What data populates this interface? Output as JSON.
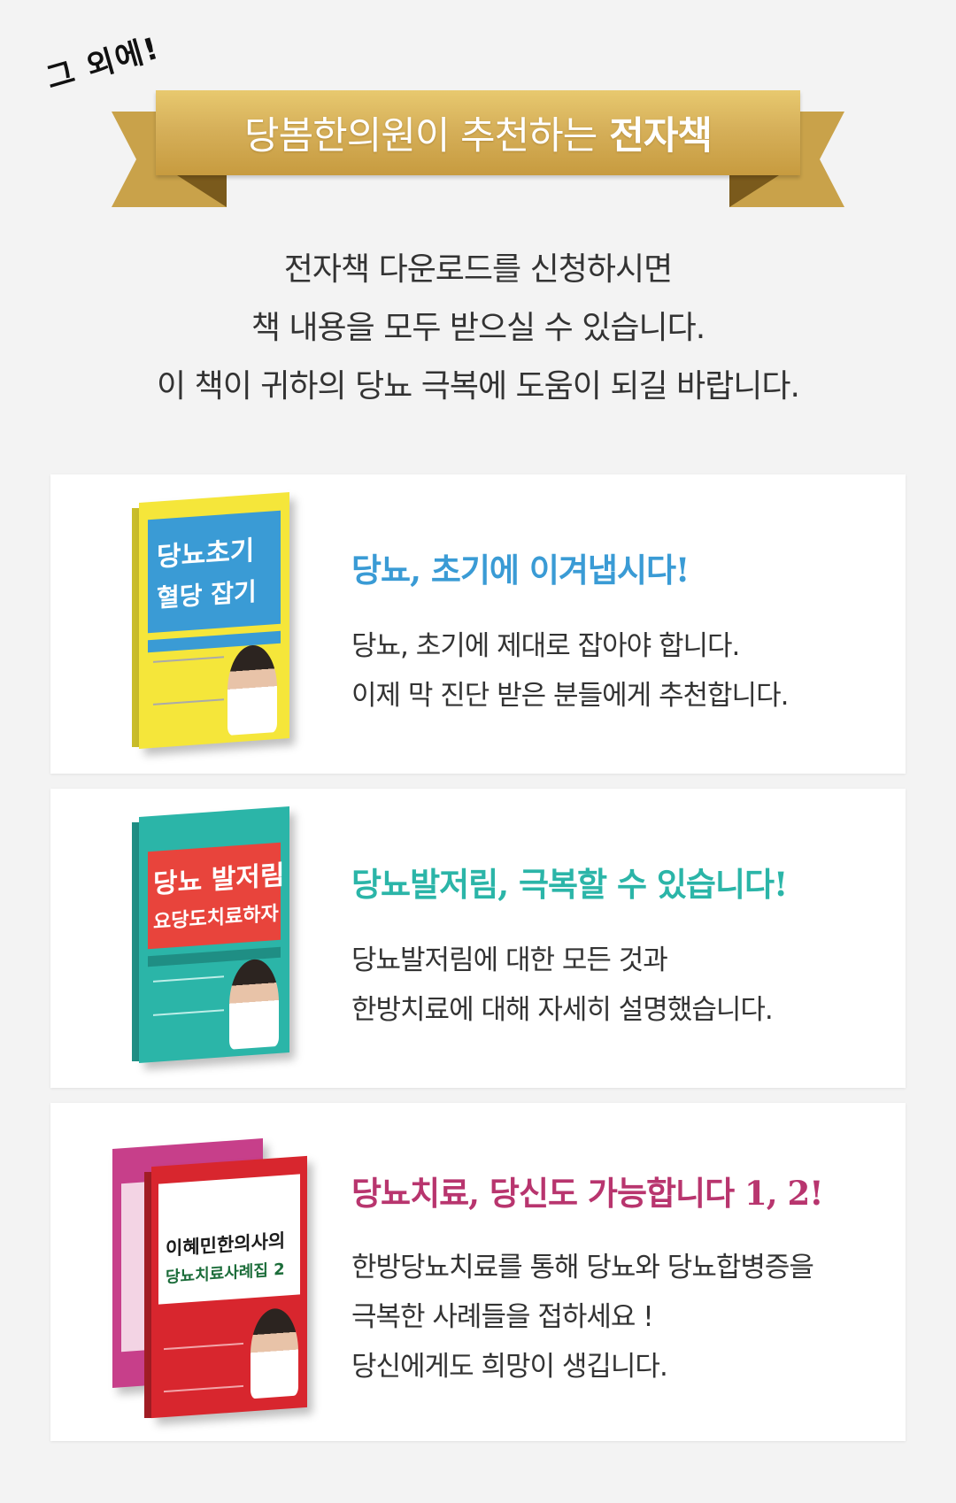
{
  "header": {
    "handwritten": "그 외에!",
    "banner_regular": "당봄한의원이 추천하는",
    "banner_bold": "전자책"
  },
  "intro": {
    "lines": [
      "전자책 다운로드를 신청하시면",
      "책 내용을 모두 받으실 수 있습니다.",
      "이 책이 귀하의 당뇨 극복에 도움이 되길 바랍니다."
    ]
  },
  "books": [
    {
      "title": "당뇨, 초기에 이겨냅시다!",
      "title_color": "#3a9bd5",
      "desc": [
        "당뇨, 초기에 제대로 잡아야 합니다.",
        "이제 막 진단 받은 분들에게 추천합니다."
      ],
      "cover_line1": "당뇨초기",
      "cover_line2": "혈당 잡기",
      "cover_bg": "#f5e63a",
      "cover_accent": "#3a9bd5"
    },
    {
      "title": "당뇨발저림, 극복할 수 있습니다!",
      "title_color": "#2bb5a8",
      "desc": [
        "당뇨발저림에 대한 모든 것과",
        "한방치료에 대해 자세히 설명했습니다."
      ],
      "cover_line1": "당뇨 발저림",
      "cover_line2": "요당도치료하자",
      "cover_bg": "#2bb5a8",
      "cover_accent": "#e8443c"
    },
    {
      "title": "당뇨치료, 당신도 가능합니다 1, 2!",
      "title_color": "#b8356e",
      "desc": [
        "한방당뇨치료를 통해 당뇨와 당뇨합병증을",
        "극복한 사례들을 접하세요 !",
        "당신에게도 희망이 생깁니다."
      ],
      "cover_line1": "이혜민한의사의",
      "cover_line2": "당뇨치료사례집 2",
      "cover_bg": "#d8262e",
      "cover_accent": "#c73f8a"
    }
  ]
}
